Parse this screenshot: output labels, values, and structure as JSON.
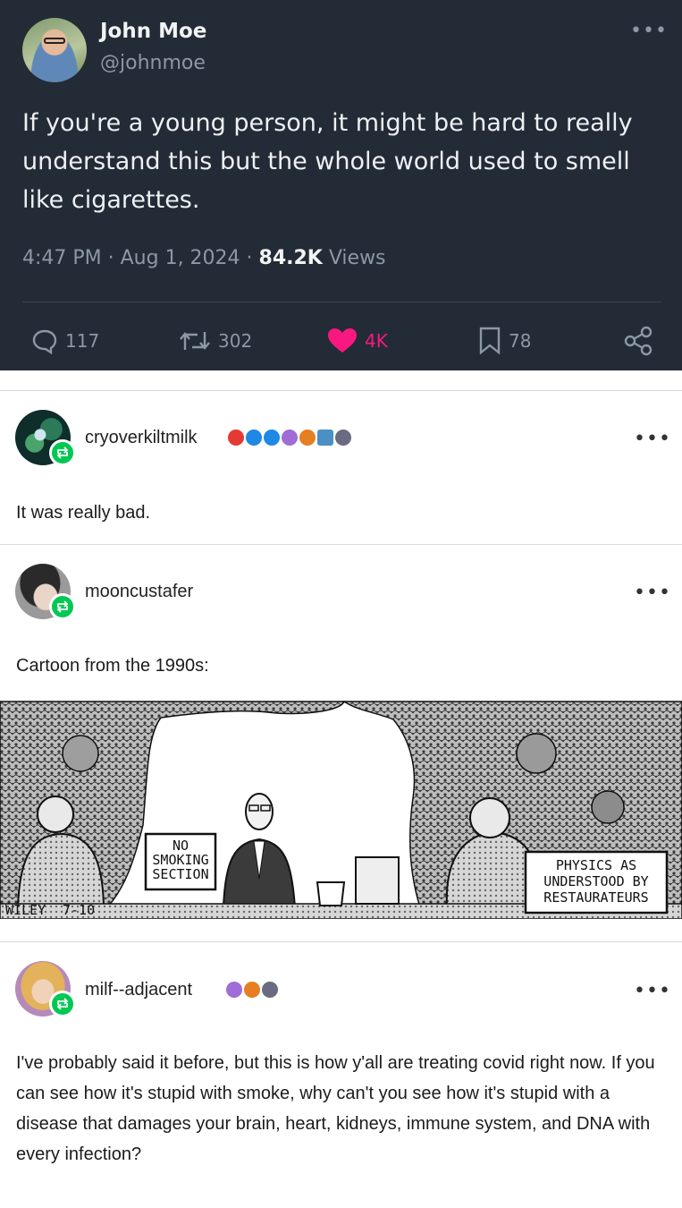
{
  "tweet": {
    "display_name": "John Moe",
    "handle": "@johnmoe",
    "text": "If you're a young person, it might be hard to really understand this but the whole world used to smell like cigarettes.",
    "time": "4:47 PM · Aug 1, 2024 · ",
    "views_count": "84.2K",
    "views_label": " Views",
    "stats": {
      "replies": "117",
      "reposts": "302",
      "likes": "4K",
      "bookmarks": "78"
    },
    "colors": {
      "background": "#232b36",
      "like": "#f91880",
      "muted": "#8b98a5"
    }
  },
  "posts": [
    {
      "username": "cryoverkiltmilk",
      "text": "It was really bad.",
      "badges": [
        "red",
        "blue-check",
        "blue-check",
        "purple",
        "orange",
        "blue",
        "gray"
      ]
    },
    {
      "username": "mooncustafer",
      "text": "Cartoon from the 1990s:",
      "image": {
        "sign_left": [
          "NO",
          "SMOKING",
          "SECTION"
        ],
        "sign_right": [
          "PHYSICS AS",
          "UNDERSTOOD BY",
          "RESTAURATEURS"
        ],
        "signature": "WILEY",
        "date": "7-10"
      }
    },
    {
      "username": "milf--adjacent",
      "text": "I've probably said it before, but this is how y'all are treating covid right now. If you can see how it's stupid with smoke, why can't you see how it's stupid with a disease that damages your brain, heart, kidneys, immune system, and DNA with every infection?",
      "badges": [
        "purple",
        "orange",
        "gray"
      ]
    }
  ],
  "icons": {
    "more": "•••",
    "reblog": "reblog-icon"
  }
}
